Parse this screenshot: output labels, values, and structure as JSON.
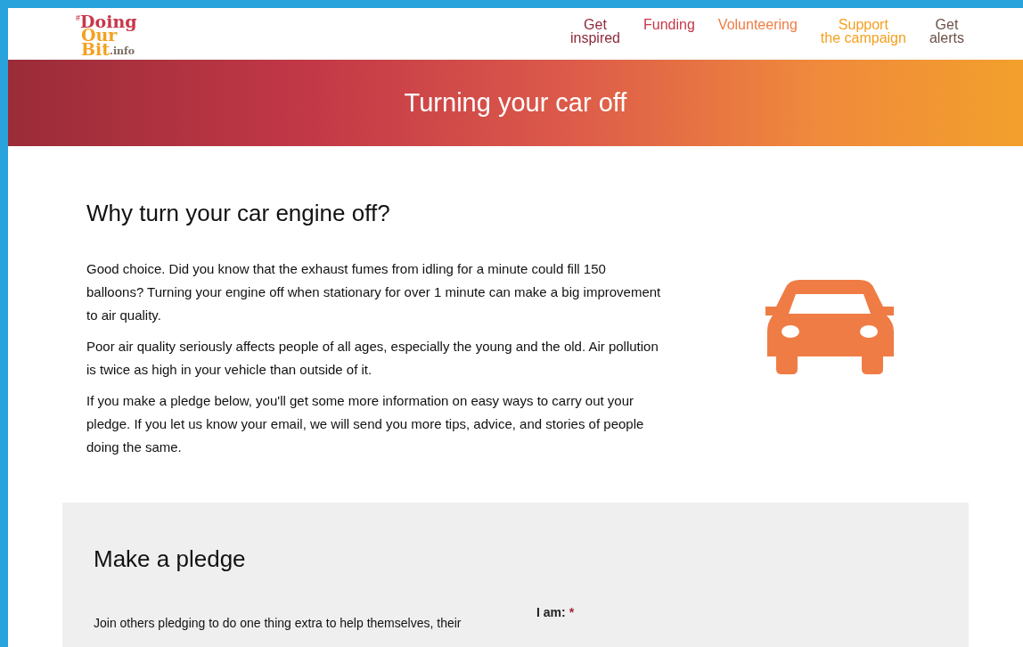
{
  "logo": {
    "hash": "#",
    "line1": "Doing",
    "line2": "Our",
    "line3": "Bit",
    "suffix": ".info"
  },
  "nav": [
    {
      "label": "Get\ninspired",
      "color": "#8e2a3a"
    },
    {
      "label": "Funding",
      "color": "#c8374a"
    },
    {
      "label": "Volunteering",
      "color": "#ef7c45"
    },
    {
      "label": "Support\nthe campaign",
      "color": "#f5a020"
    },
    {
      "label": "Get\nalerts",
      "color": "#6b5248"
    }
  ],
  "banner": {
    "title": "Turning your car off"
  },
  "intro": {
    "heading": "Why turn your car engine off?",
    "paragraphs": [
      "Good choice. Did you know that the exhaust fumes from idling for a minute could fill 150 balloons? Turning your engine off when stationary for over 1 minute can make a big improvement to air quality.",
      "Poor air quality seriously affects people of all ages, especially the young and the old. Air pollution is twice as high in your vehicle than outside of it.",
      "If you make a pledge below, you'll get some more information on easy ways to carry out your pledge. If you let us know your email, we will send you more tips, advice, and stories of people doing the same."
    ]
  },
  "pledge": {
    "heading": "Make a pledge",
    "text": "Join others pledging to do one thing extra to help themselves, their",
    "field_label": "I am:",
    "required_mark": "*"
  }
}
